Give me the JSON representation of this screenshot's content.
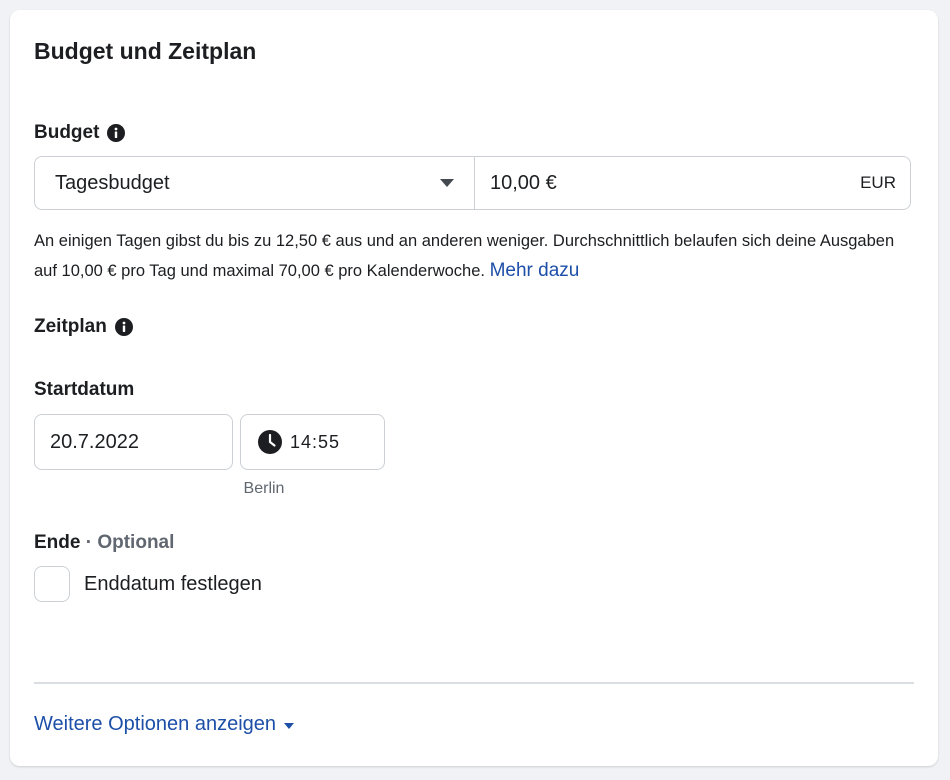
{
  "section": {
    "title": "Budget und Zeitplan"
  },
  "budget": {
    "label": "Budget",
    "info_icon": "info-icon",
    "type_selected": "Tagesbudget",
    "amount": "10,00 €",
    "currency": "EUR",
    "help_text": "An einigen Tagen gibst du bis zu 12,50 € aus und an anderen weniger. Durchschnittlich belaufen sich deine Ausgaben auf 10,00 € pro Tag und maximal 70,00 € pro Kalenderwoche. ",
    "help_link": "Mehr dazu"
  },
  "schedule": {
    "label": "Zeitplan",
    "info_icon": "info-icon",
    "start_label": "Startdatum",
    "start_date": "20.7.2022",
    "start_time": "14:55",
    "clock_icon": "clock-icon",
    "timezone": "Berlin",
    "end_label": "Ende",
    "end_separator": " · ",
    "end_optional": "Optional",
    "end_checkbox_label": "Enddatum festlegen"
  },
  "footer": {
    "more_options": "Weitere Optionen anzeigen",
    "caret_icon": "caret-down-icon"
  },
  "colors": {
    "link": "#1d4fa8",
    "text": "#1c1e21",
    "muted": "#606770",
    "border": "#ccd0d5"
  }
}
